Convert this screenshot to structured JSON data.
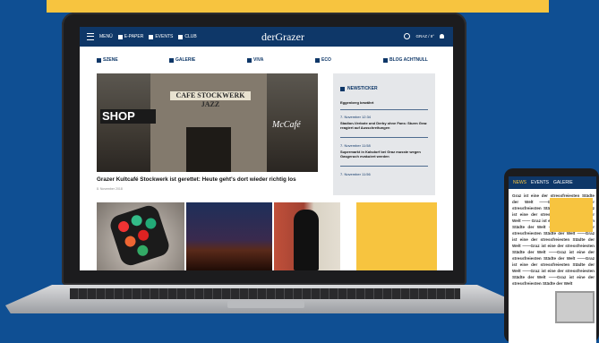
{
  "colors": {
    "brand_navy": "#0e3768",
    "accent_yellow": "#f7c43f",
    "background_blue": "#0f4f93"
  },
  "site": {
    "logo": "derGrazer",
    "nav": {
      "menu": "MENÜ",
      "epaper": "E-PAPER",
      "events": "EVENTS",
      "club": "CLUB",
      "weather": "GRAZ / 9°"
    },
    "categories": [
      "SZENE",
      "GALERIE",
      "VIVA",
      "ECO",
      "BLOG ACHTNULL"
    ],
    "hero": {
      "shop_sign": "SHOP",
      "cafe_sign": "CAFE STOCKWERK JAZZ",
      "script_sign": "McCafé",
      "headline": "Grazer Kultcafé Stockwerk ist gerettet: Heute geht's dort wieder richtig los",
      "meta": "8. November 2018"
    },
    "ticker": {
      "title": "NEWSTICKER",
      "items": [
        {
          "time": "",
          "text": "Eggenberg bewährt"
        },
        {
          "time": "7. November 12:34",
          "text": "Stadion-Verbote und Derby ohne Fans: Sturm Graz reagiert auf Ausschreitungen"
        },
        {
          "time": "7. November 11:58",
          "text": "Supermarkt in Kalsdorf bei Graz musste wegen Gasgeruch evakuiert werden"
        },
        {
          "time": "7. November 11:56",
          "text": ""
        }
      ]
    }
  },
  "phone": {
    "tabs": [
      "NEWS",
      "EVENTS",
      "GALERIE"
    ],
    "body": "Graz ist eine der stressfreiesten Städte der Welt ——Graz ist eine der stressfreiesten Städte der Welt ——Graz ist eine der stressfreiesten Städte der Welt —— Graz ist eine der stressfreiesten Städte der Welt ——Graz ist eine der stressfreiesten Städte der Welt ——Graz ist eine der stressfreiesten Städte der Welt ——Graz ist eine der stressfreiesten Städte der Welt ——Graz ist eine der stressfreiesten Städte der Welt ——Graz ist eine der stressfreiesten Städte der Welt ——Graz ist eine der stressfreiesten Städte der Welt ——Graz ist eine der stressfreiesten Städte der Welt"
  }
}
